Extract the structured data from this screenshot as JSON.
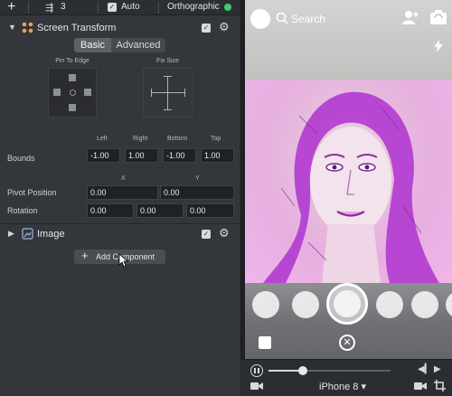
{
  "topbar": {
    "add_icon": "plus-icon",
    "object_count": "3",
    "auto_label": "Auto",
    "auto_checked": true,
    "projection_label": "Orthographic",
    "status_color": "#3fcf6c"
  },
  "screen_transform": {
    "title": "Screen Transform",
    "enabled": true,
    "tabs": {
      "basic": "Basic",
      "advanced": "Advanced",
      "active": "Basic"
    },
    "pin_to_edge_label": "Pin To Edge",
    "fix_size_label": "Fix Size",
    "bounds": {
      "label": "Bounds",
      "columns": [
        "Left",
        "Right",
        "Bottom",
        "Top"
      ],
      "values": [
        "-1.00",
        "1.00",
        "-1.00",
        "1.00"
      ]
    },
    "axis_labels": [
      "X",
      "Y"
    ],
    "pivot_position": {
      "label": "Pivot Position",
      "values": [
        "0.00",
        "0.00"
      ]
    },
    "rotation": {
      "label": "Rotation",
      "values": [
        "0.00",
        "0.00",
        "0.00"
      ]
    }
  },
  "image_component": {
    "title": "Image",
    "enabled": true
  },
  "add_component_label": "Add Component",
  "preview": {
    "search_label": "Search",
    "icons": [
      "add-friend-icon",
      "flip-camera-icon",
      "flash-icon",
      "memories-icon",
      "close-icon",
      "face-lens-icon",
      "stories-icon"
    ]
  },
  "playback": {
    "progress": 0.28,
    "device_label": "iPhone 8"
  },
  "colors": {
    "panel_bg": "#33363a",
    "field_bg": "#1f2124",
    "accent_green": "#3fcf6c",
    "filter_magenta": "#b13ad0"
  }
}
